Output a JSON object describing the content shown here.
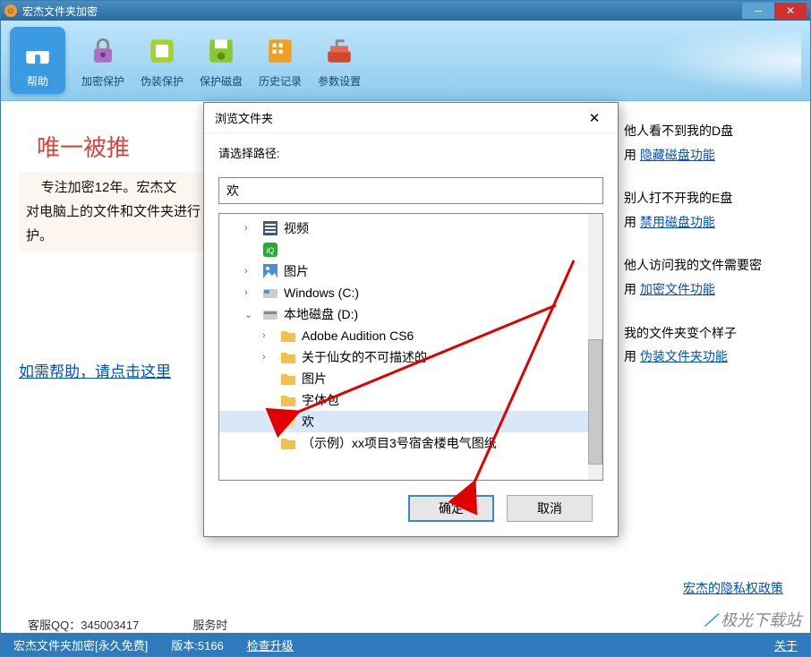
{
  "window": {
    "title": "宏杰文件夹加密"
  },
  "toolbar": {
    "items": [
      {
        "label": "帮助",
        "icon": "home",
        "active": true
      },
      {
        "label": "加密保护",
        "icon": "lock",
        "active": false
      },
      {
        "label": "伪装保护",
        "icon": "disguise",
        "active": false
      },
      {
        "label": "保护磁盘",
        "icon": "disk",
        "active": false
      },
      {
        "label": "历史记录",
        "icon": "history",
        "active": false
      },
      {
        "label": "参数设置",
        "icon": "settings",
        "active": false
      }
    ]
  },
  "main": {
    "banner": "唯一被推",
    "intro_line1": "专注加密12年。宏杰文",
    "intro_line2": "对电脑上的文件和文件夹进行",
    "intro_line3": "护。",
    "help_link": "如需帮助，请点击这里"
  },
  "right": {
    "items": [
      {
        "text": "他人看不到我的D盘",
        "link_prefix": "用 ",
        "link": "隐藏磁盘功能"
      },
      {
        "text": "别人打不开我的E盘",
        "link_prefix": "用 ",
        "link": "禁用磁盘功能"
      },
      {
        "text": "他人访问我的文件需要密",
        "link_prefix": "用 ",
        "link": "加密文件功能"
      },
      {
        "text": "我的文件夹变个样子",
        "link_prefix": "用 ",
        "link": "伪装文件夹功能"
      }
    ]
  },
  "footer": {
    "qq_label": "客服QQ：",
    "qq": "345003417",
    "service": "服务时",
    "privacy": "宏杰的隐私权政策",
    "watermark": "极光下载站"
  },
  "statusbar": {
    "app": "宏杰文件夹加密[永久免费]",
    "version_label": "版本:",
    "version": "5166",
    "check": "检查升级",
    "about": "关于"
  },
  "dialog": {
    "title": "浏览文件夹",
    "prompt": "请选择路径:",
    "input": "欢",
    "ok": "确定",
    "cancel": "取消",
    "tree": [
      {
        "level": 1,
        "exp": ">",
        "icon": "video",
        "label": "视频"
      },
      {
        "level": 1,
        "exp": "",
        "icon": "iqiyi",
        "label": ""
      },
      {
        "level": 1,
        "exp": ">",
        "icon": "pic",
        "label": "图片"
      },
      {
        "level": 1,
        "exp": ">",
        "icon": "winc",
        "label": "Windows (C:)"
      },
      {
        "level": 1,
        "exp": "v",
        "icon": "diskd",
        "label": "本地磁盘 (D:)"
      },
      {
        "level": 2,
        "exp": ">",
        "icon": "folder",
        "label": "Adobe Audition CS6"
      },
      {
        "level": 2,
        "exp": ">",
        "icon": "folder",
        "label": "关于仙女的不可描述的"
      },
      {
        "level": 2,
        "exp": "",
        "icon": "folder",
        "label": "图片"
      },
      {
        "level": 2,
        "exp": "",
        "icon": "folder",
        "label": "字体包"
      },
      {
        "level": 2,
        "exp": "",
        "icon": "folder-open",
        "label": "欢",
        "selected": true
      },
      {
        "level": 2,
        "exp": "",
        "icon": "folder",
        "label": "（示例）xx项目3号宿舍楼电气图纸"
      }
    ]
  }
}
